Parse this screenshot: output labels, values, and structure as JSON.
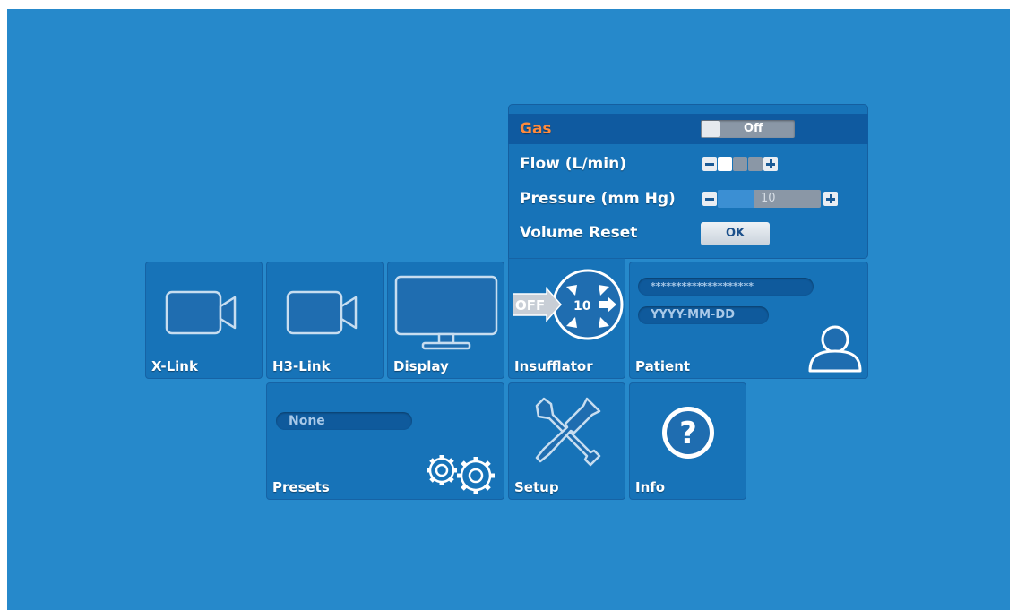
{
  "insufflator_panel": {
    "gas": {
      "label": "Gas",
      "state": "Off"
    },
    "flow": {
      "label": "Flow (L/min)",
      "level": 1,
      "max_level": 4
    },
    "pressure": {
      "label": "Pressure (mm Hg)",
      "value": "10",
      "fill_fraction": 0.35
    },
    "volume_reset": {
      "label": "Volume Reset",
      "button": "OK"
    }
  },
  "tiles": {
    "xlink": {
      "label": "X-Link",
      "icon": "video-camera-icon"
    },
    "h3link": {
      "label": "H3-Link",
      "icon": "video-camera-icon"
    },
    "display": {
      "label": "Display",
      "icon": "monitor-icon"
    },
    "insufflator": {
      "label": "Insufflator",
      "icon": "insufflator-icon",
      "badge_off": "OFF",
      "badge_value": "10"
    },
    "patient": {
      "label": "Patient",
      "icon": "person-icon",
      "id_field": "********************",
      "date_field": "YYYY-MM-DD"
    },
    "presets": {
      "label": "Presets",
      "icon": "gears-icon",
      "value": "None"
    },
    "setup": {
      "label": "Setup",
      "icon": "tools-icon"
    },
    "info": {
      "label": "Info",
      "icon": "question-icon"
    }
  },
  "colors": {
    "background": "#2689cb",
    "tile": "#1773b8",
    "gas_label": "#ff8a3c"
  }
}
